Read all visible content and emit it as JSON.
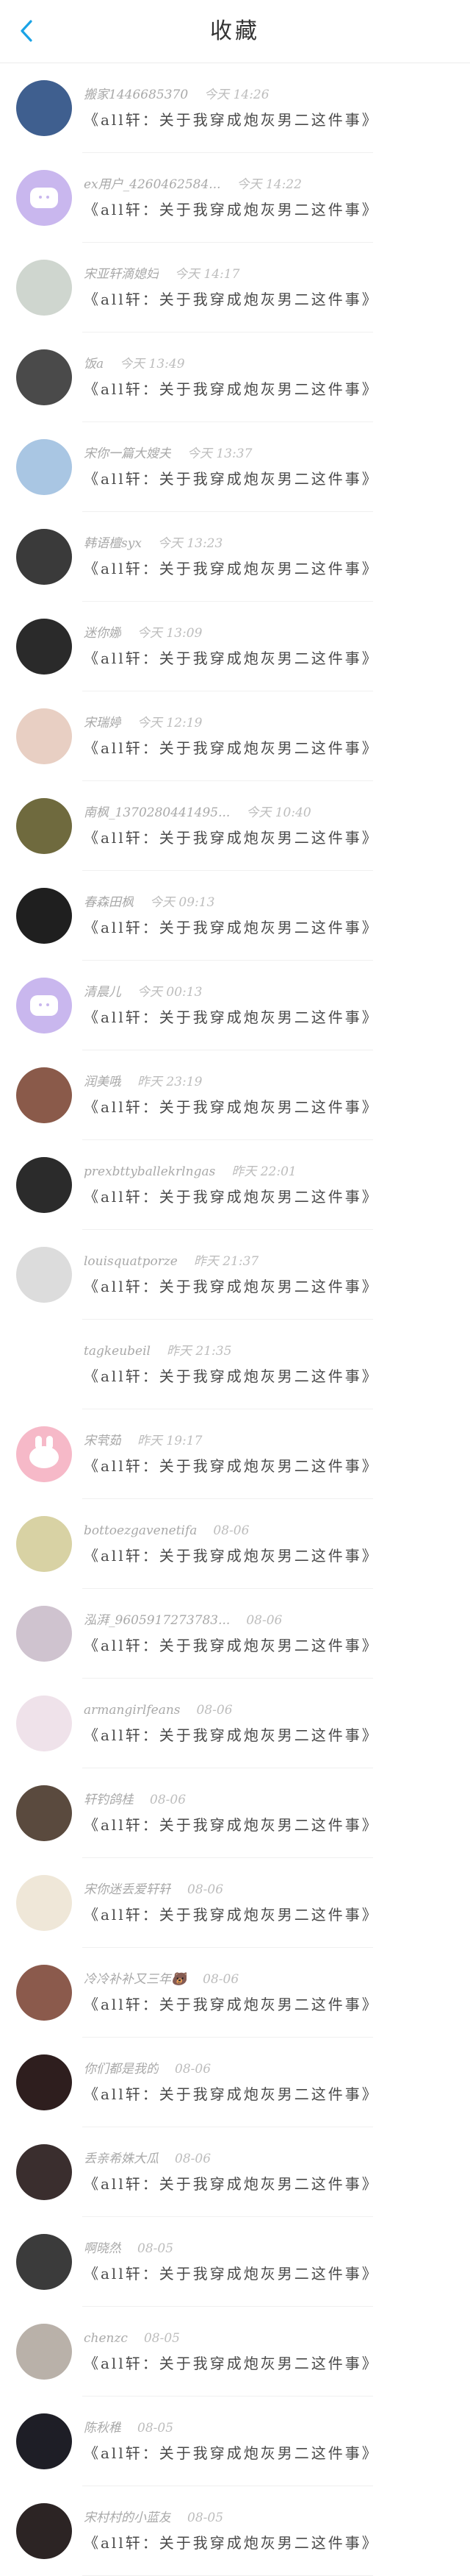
{
  "header": {
    "title": "收藏"
  },
  "items": [
    {
      "name": "搬家1446685370",
      "time": "今天 14:26",
      "content": "《all轩：关于我穿成炮灰男二这件事》",
      "avatar_color": "#3f5f8f",
      "avatar_type": "photo"
    },
    {
      "name": "ex用户_4260462584...",
      "time": "今天 14:22",
      "content": "《all轩：关于我穿成炮灰男二这件事》",
      "avatar_color": "#c9b7ee",
      "avatar_type": "ghost"
    },
    {
      "name": "宋亚轩滴媳妇",
      "time": "今天 14:17",
      "content": "《all轩：关于我穿成炮灰男二这件事》",
      "avatar_color": "#cfd6cf",
      "avatar_type": "photo"
    },
    {
      "name": "饭a",
      "time": "今天 13:49",
      "content": "《all轩：关于我穿成炮灰男二这件事》",
      "avatar_color": "#4a4a4a",
      "avatar_type": "photo"
    },
    {
      "name": "宋你一篇大嫂夫",
      "time": "今天 13:37",
      "content": "《all轩：关于我穿成炮灰男二这件事》",
      "avatar_color": "#a9c6e3",
      "avatar_type": "photo"
    },
    {
      "name": "韩语檀syx",
      "time": "今天 13:23",
      "content": "《all轩：关于我穿成炮灰男二这件事》",
      "avatar_color": "#3a3a3a",
      "avatar_type": "photo"
    },
    {
      "name": "迷你娜",
      "time": "今天 13:09",
      "content": "《all轩：关于我穿成炮灰男二这件事》",
      "avatar_color": "#2a2a2a",
      "avatar_type": "photo"
    },
    {
      "name": "宋瑞婷",
      "time": "今天 12:19",
      "content": "《all轩：关于我穿成炮灰男二这件事》",
      "avatar_color": "#e8cfc3",
      "avatar_type": "photo"
    },
    {
      "name": "南枫_1370280441495...",
      "time": "今天 10:40",
      "content": "《all轩：关于我穿成炮灰男二这件事》",
      "avatar_color": "#6f6a3e",
      "avatar_type": "photo"
    },
    {
      "name": "春森田枫",
      "time": "今天 09:13",
      "content": "《all轩：关于我穿成炮灰男二这件事》",
      "avatar_color": "#1f1f1f",
      "avatar_type": "photo"
    },
    {
      "name": "清晨儿",
      "time": "今天 00:13",
      "content": "《all轩：关于我穿成炮灰男二这件事》",
      "avatar_color": "#c9b7ee",
      "avatar_type": "ghost"
    },
    {
      "name": "润美哦",
      "time": "昨天 23:19",
      "content": "《all轩：关于我穿成炮灰男二这件事》",
      "avatar_color": "#8a5a4a",
      "avatar_type": "photo"
    },
    {
      "name": "prexbttyballekrlngas",
      "time": "昨天 22:01",
      "content": "《all轩：关于我穿成炮灰男二这件事》",
      "avatar_color": "#2b2b2b",
      "avatar_type": "photo"
    },
    {
      "name": "louisquatporze",
      "time": "昨天 21:37",
      "content": "《all轩：关于我穿成炮灰男二这件事》",
      "avatar_color": "#dcdcdc",
      "avatar_type": "photo"
    },
    {
      "name": "tagkeubeil",
      "time": "昨天 21:35",
      "content": "《all轩：关于我穿成炮灰男二这件事》",
      "avatar_color": "#ffffff",
      "avatar_type": "blank"
    },
    {
      "name": "宋茕茹",
      "time": "昨天 19:17",
      "content": "《all轩：关于我穿成炮灰男二这件事》",
      "avatar_color": "#f6b9c8",
      "avatar_type": "bunny"
    },
    {
      "name": "bottoezgavenetifa",
      "time": "08-06",
      "content": "《all轩：关于我穿成炮灰男二这件事》",
      "avatar_color": "#d8d2a4",
      "avatar_type": "photo"
    },
    {
      "name": "泓湃_9605917273783...",
      "time": "08-06",
      "content": "《all轩：关于我穿成炮灰男二这件事》",
      "avatar_color": "#cfc3cf",
      "avatar_type": "photo"
    },
    {
      "name": "armangirlfeans",
      "time": "08-06",
      "content": "《all轩：关于我穿成炮灰男二这件事》",
      "avatar_color": "#efe2ea",
      "avatar_type": "photo"
    },
    {
      "name": "轩钓鸽桂",
      "time": "08-06",
      "content": "《all轩：关于我穿成炮灰男二这件事》",
      "avatar_color": "#5a4a3e",
      "avatar_type": "photo"
    },
    {
      "name": "宋你迷丢爱轩轩",
      "time": "08-06",
      "content": "《all轩：关于我穿成炮灰男二这件事》",
      "avatar_color": "#efe7d8",
      "avatar_type": "photo"
    },
    {
      "name": "冷冷补补又三年🐻",
      "time": "08-06",
      "content": "《all轩：关于我穿成炮灰男二这件事》",
      "avatar_color": "#8b5a4c",
      "avatar_type": "photo"
    },
    {
      "name": "你们都是我的",
      "time": "08-06",
      "content": "《all轩：关于我穿成炮灰男二这件事》",
      "avatar_color": "#2e1e1e",
      "avatar_type": "photo"
    },
    {
      "name": "丢亲希姝大瓜",
      "time": "08-06",
      "content": "《all轩：关于我穿成炮灰男二这件事》",
      "avatar_color": "#3a2e2e",
      "avatar_type": "photo"
    },
    {
      "name": "啊晓然",
      "time": "08-05",
      "content": "《all轩：关于我穿成炮灰男二这件事》",
      "avatar_color": "#3b3b3b",
      "avatar_type": "photo"
    },
    {
      "name": "chenzc",
      "time": "08-05",
      "content": "《all轩：关于我穿成炮灰男二这件事》",
      "avatar_color": "#b9b1a9",
      "avatar_type": "photo"
    },
    {
      "name": "陈秋稚",
      "time": "08-05",
      "content": "《all轩：关于我穿成炮灰男二这件事》",
      "avatar_color": "#1e1e26",
      "avatar_type": "photo"
    },
    {
      "name": "宋村村的小蓝友",
      "time": "08-05",
      "content": "《all轩：关于我穿成炮灰男二这件事》",
      "avatar_color": "#2c2424",
      "avatar_type": "photo"
    }
  ]
}
